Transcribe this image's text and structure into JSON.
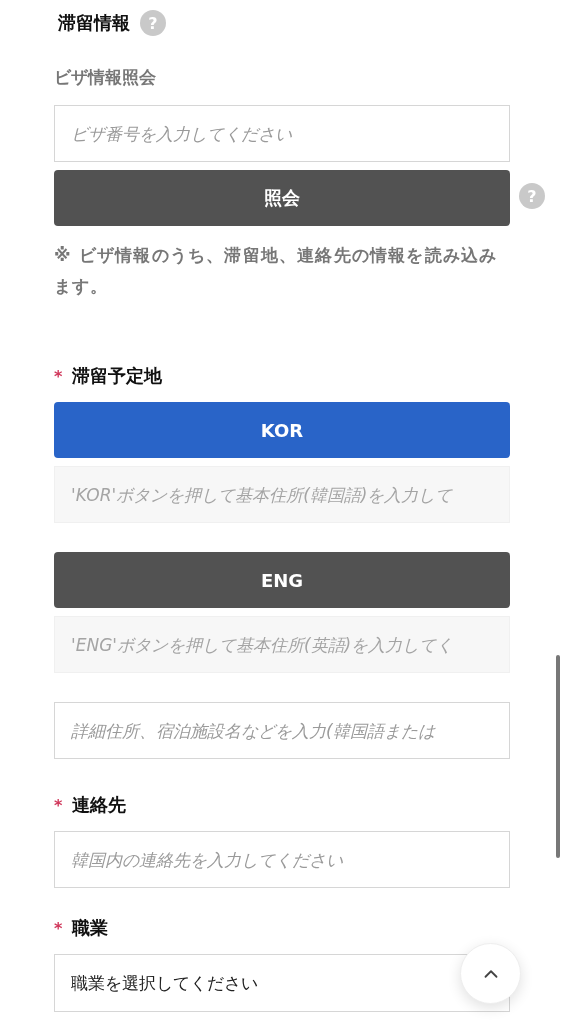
{
  "section": {
    "title": "滞留情報",
    "help": "?"
  },
  "visa_lookup": {
    "label": "ビザ情報照会",
    "field": {
      "placeholder": "ビザ番号を入力してください"
    },
    "button": "照会",
    "help": "?",
    "note": "※ ビザ情報のうち、滞留地、連絡先の情報を読み込みます。"
  },
  "stay_address": {
    "label": "滞留予定地",
    "required": "*",
    "lookups": [
      {
        "button": "KOR",
        "selected": true,
        "field": {
          "placeholder": "'KOR'ボタンを押して基本住所(韓国語)を入力して",
          "disabled": true
        }
      },
      {
        "button": "ENG",
        "selected": false,
        "field": {
          "placeholder": "'ENG'ボタンを押して基本住所(英語)を入力してく",
          "disabled": true
        }
      }
    ],
    "detail": {
      "placeholder": "詳細住所、宿泊施設名などを入力(韓国語または",
      "disabled": false
    }
  },
  "contact": {
    "label": "連絡先",
    "required": "*",
    "field": {
      "placeholder": "韓国内の連絡先を入力してください",
      "disabled": false
    }
  },
  "occupation": {
    "label": "職業",
    "required": "*",
    "select": {
      "value": "職業を選択してください"
    }
  }
}
